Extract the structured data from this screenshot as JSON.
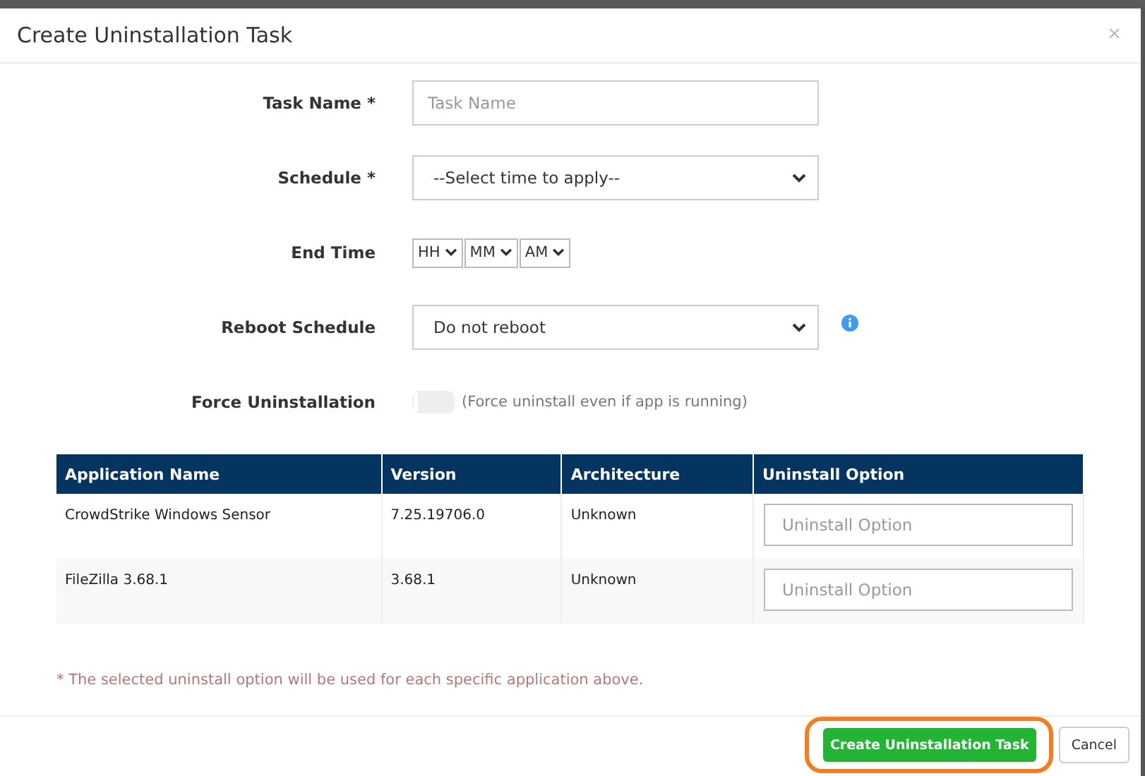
{
  "dialog": {
    "title": "Create Uninstallation Task",
    "close": "×"
  },
  "form": {
    "task_name": {
      "label": "Task Name *",
      "placeholder": "Task Name"
    },
    "schedule": {
      "label": "Schedule *",
      "value": "--Select time to apply--"
    },
    "end_time": {
      "label": "End Time",
      "hour": "HH",
      "minute": "MM",
      "period": "AM"
    },
    "reboot_schedule": {
      "label": "Reboot Schedule",
      "value": "Do not reboot"
    },
    "force_uninstallation": {
      "label": "Force Uninstallation",
      "on": false,
      "hint": "(Force uninstall even if app is running)"
    }
  },
  "table": {
    "columns": [
      "Application Name",
      "Version",
      "Architecture",
      "Uninstall Option"
    ],
    "rows": [
      {
        "application_name": "CrowdStrike Windows Sensor",
        "version": "7.25.19706.0",
        "architecture": "Unknown",
        "uninstall_option_placeholder": "Uninstall Option"
      },
      {
        "application_name": "FileZilla 3.68.1",
        "version": "3.68.1",
        "architecture": "Unknown",
        "uninstall_option_placeholder": "Uninstall Option"
      }
    ]
  },
  "note": "* The selected uninstall option will be used for each specific application above.",
  "buttons": {
    "create": {
      "label": "Create Uninstallation Task",
      "highlighted": true
    },
    "cancel": {
      "label": "Cancel"
    }
  }
}
